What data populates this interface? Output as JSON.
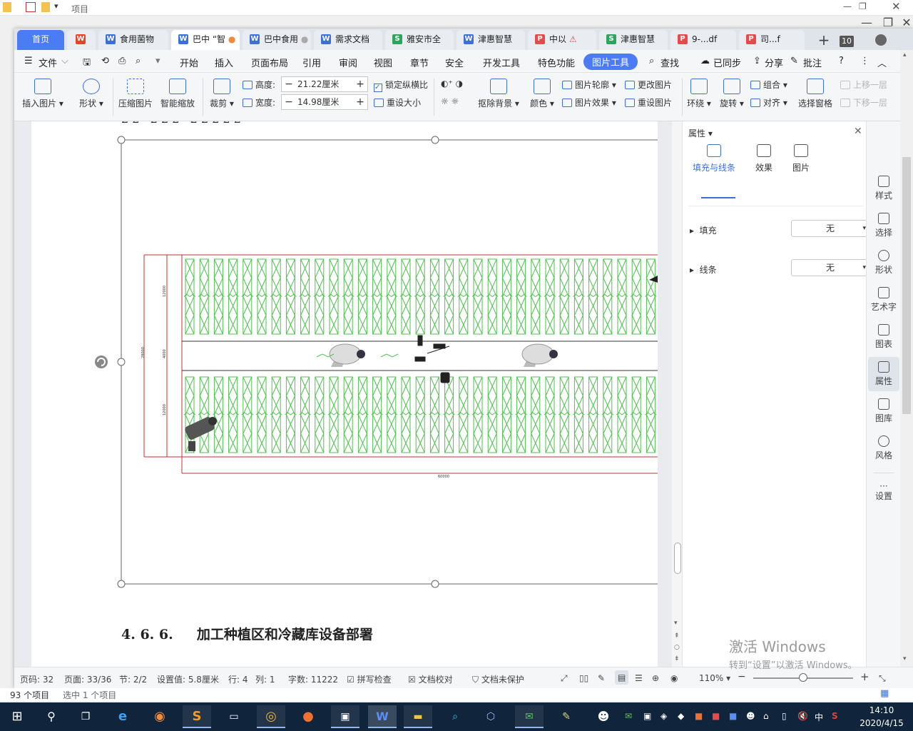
{
  "explorer": {
    "title": "项目",
    "status_count": "93 个项目",
    "status_selected": "选中 1 个项目"
  },
  "tabs": [
    {
      "label": "首页",
      "type": "home"
    },
    {
      "label": "",
      "type": "wps-logo"
    },
    {
      "label": "食用菌物",
      "type": "writer"
    },
    {
      "label": "巴中 “智",
      "type": "writer",
      "active": true
    },
    {
      "label": "巴中食用",
      "type": "writer"
    },
    {
      "label": "需求文档",
      "type": "writer"
    },
    {
      "label": "雅安市全",
      "type": "sheet"
    },
    {
      "label": "津惠智慧",
      "type": "writer"
    },
    {
      "label": "中以",
      "type": "pdf"
    },
    {
      "label": "津惠智慧",
      "type": "sheet"
    },
    {
      "label": "9-...df",
      "type": "pdf"
    },
    {
      "label": "司...f",
      "type": "pdf"
    }
  ],
  "tab_count": "10",
  "menu": [
    "文件",
    "开始",
    "插入",
    "页面布局",
    "引用",
    "审阅",
    "视图",
    "章节",
    "安全",
    "开发工具",
    "特色功能",
    "图片工具",
    "查找"
  ],
  "menu_active": "图片工具",
  "menu_right": {
    "sync": "已同步",
    "share": "分享",
    "comment": "批注"
  },
  "ribbon": {
    "insert_picture": "插入图片",
    "shape": "形状",
    "compress": "压缩图片",
    "smart_zoom": "智能缩放",
    "crop": "裁剪",
    "height_label": "高度:",
    "height_value": "21.22厘米",
    "width_label": "宽度:",
    "width_value": "14.98厘米",
    "lock_ratio": "锁定纵横比",
    "reset_size": "重设大小",
    "remove_bg": "抠除背景",
    "color": "颜色",
    "outline": "图片轮廓",
    "effect": "图片效果",
    "change_pic": "更改图片",
    "reset_pic": "重设图片",
    "wrap": "环绕",
    "rotate": "旋转",
    "group": "组合",
    "align": "对齐",
    "selection_pane": "选择窗格",
    "bring_forward": "上移一层",
    "send_backward": "下移一层"
  },
  "document": {
    "heading_num": "4. 6. 6.",
    "heading_text": "加工种植区和冷藏库设备部署",
    "dim_top": "12000",
    "dim_mid": "4000",
    "dim_bottom": "12000",
    "dim_total": "28000",
    "dim_length": "60000"
  },
  "props": {
    "title": "属性",
    "tabs": [
      "填充与线条",
      "效果",
      "图片"
    ],
    "fill_label": "填充",
    "fill_value": "无",
    "line_label": "线条",
    "line_value": "无"
  },
  "right_bar": [
    "样式",
    "选择",
    "形状",
    "艺术字",
    "图表",
    "属性",
    "图库",
    "风格",
    "设置"
  ],
  "status": {
    "page_num": "页码: 32",
    "pages": "页面: 33/36",
    "section": "节: 2/2",
    "setting": "设置值: 5.8厘米",
    "row": "行: 4",
    "col": "列: 1",
    "words": "字数: 11222",
    "spell": "拼写检查",
    "proof": "文档校对",
    "protect": "文档未保护",
    "zoom": "110%"
  },
  "watermark": {
    "line1": "激活 Windows",
    "line2": "转到“设置”以激活 Windows。"
  },
  "clock": {
    "time": "14:10",
    "date": "2020/4/15"
  },
  "tray_lang": "中"
}
